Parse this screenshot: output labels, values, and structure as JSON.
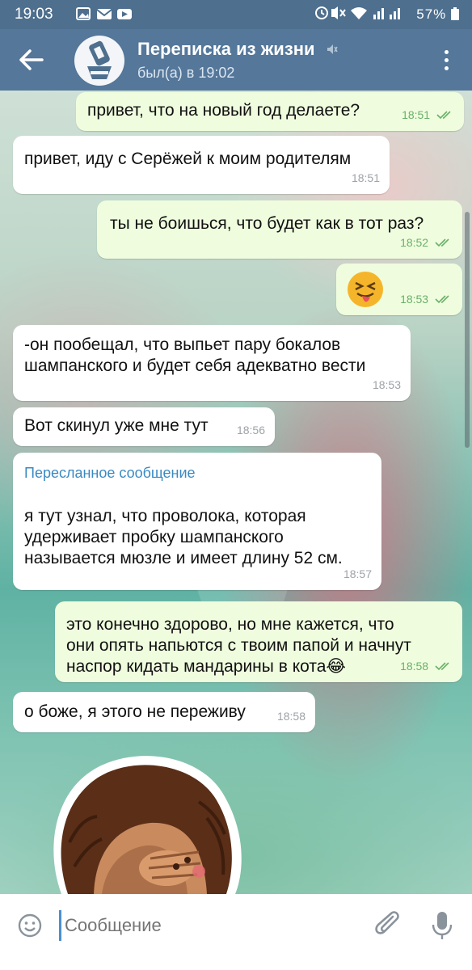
{
  "status_bar": {
    "time": "19:03",
    "battery": "57%"
  },
  "header": {
    "title": "Переписка из жизни",
    "subtitle": "был(а) в 19:02"
  },
  "messages": [
    {
      "direction": "out",
      "text": "привет, что на новый год делаете?",
      "time": "18:51",
      "read": true
    },
    {
      "direction": "in",
      "text": "привет, иду с Серёжей к моим родителям",
      "time": "18:51"
    },
    {
      "direction": "out",
      "text": "ты не боишься, что будет как в тот раз?",
      "time": "18:52",
      "read": true
    },
    {
      "direction": "out",
      "text": "",
      "emoji": "squinting-face-with-tongue",
      "time": "18:53",
      "read": true
    },
    {
      "direction": "in",
      "text": "-он пообещал, что выпьет пару бокалов шампанского и будет себя адекватно вести",
      "time": "18:53"
    },
    {
      "direction": "in",
      "text": "Вот скинул уже мне тут",
      "time": "18:56"
    },
    {
      "direction": "in",
      "forwarded_label": "Пересланное сообщение",
      "text": "я тут узнал, что проволока, которая удерживает пробку шампанского называется мюзле и имеет длину 52 см.",
      "time": "18:57"
    },
    {
      "direction": "out",
      "text": "это конечно здорово, но мне кажется, что они опять напьются с твоим папой и начнут наспор кидать мандарины в кота😂",
      "time": "18:58",
      "read": true
    },
    {
      "direction": "in",
      "text": "о боже, я этого не переживу",
      "time": "18:58"
    }
  ],
  "sticker": "woman-facepalm-sticker",
  "input": {
    "placeholder": "Сообщение"
  },
  "colors": {
    "header": "#54779a",
    "status_bar": "#4e6f8e",
    "outgoing_bubble": "#effdde",
    "incoming_bubble": "#ffffff",
    "link": "#3a8ac2",
    "read_check": "#6ab06a"
  }
}
